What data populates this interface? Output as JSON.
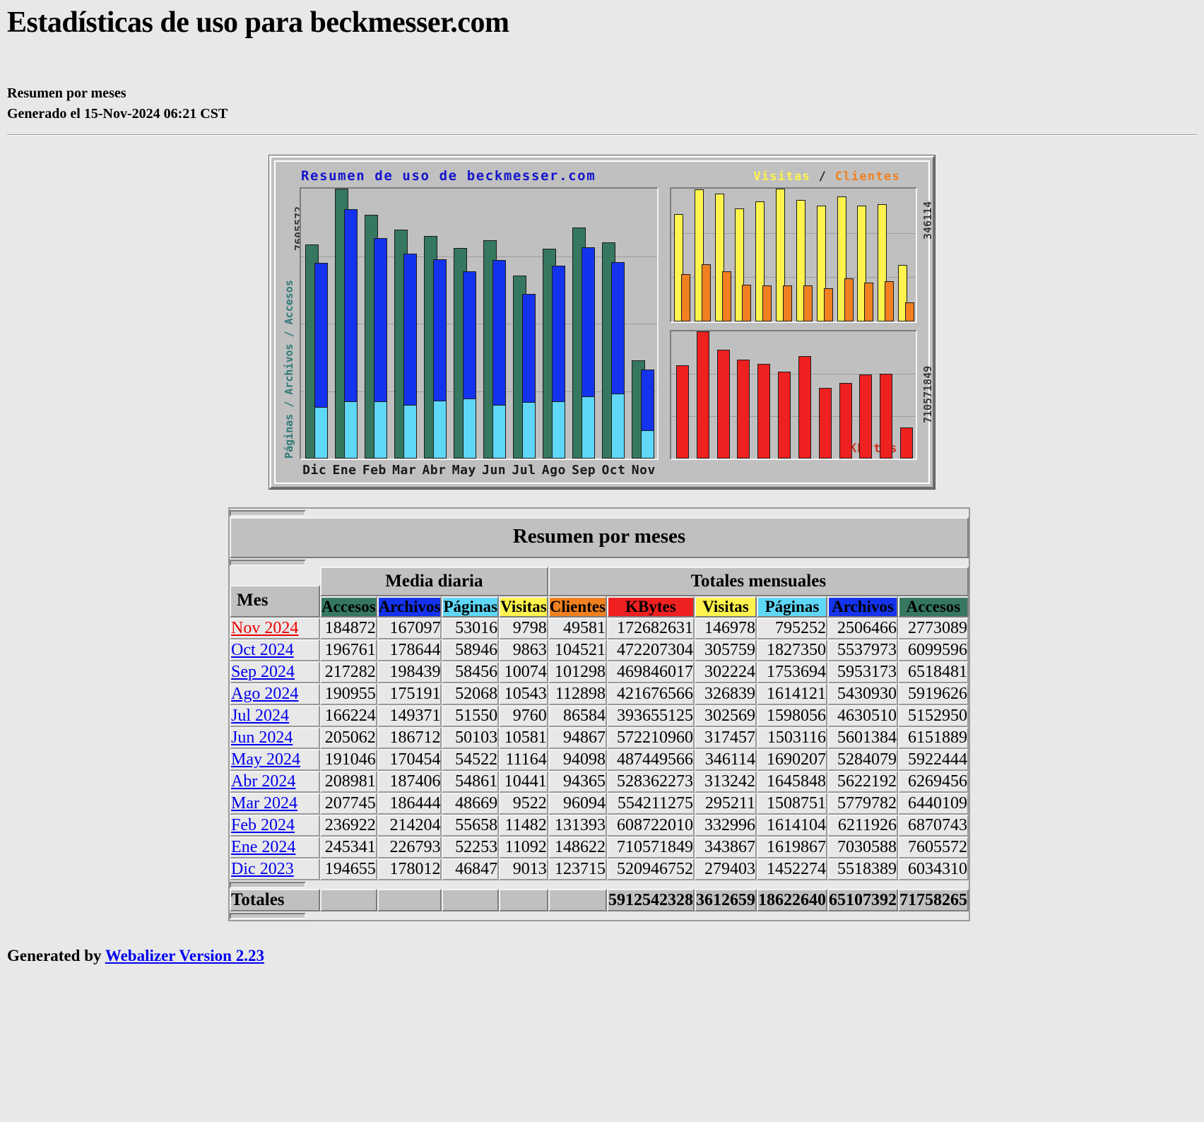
{
  "page": {
    "title": "Estadísticas de uso para beckmesser.com",
    "subtitle": "Resumen por meses",
    "generated": "Generado el 15-Nov-2024 06:21 CST"
  },
  "graph": {
    "title": "Resumen de uso de beckmesser.com",
    "legend_visits": "Visitas",
    "legend_sep": "/",
    "legend_sites": "Clientes",
    "left_axis_max": "7605572",
    "left_axis_label": "Páginas / Archivos / Accesos",
    "right_axis_top_max": "346114",
    "right_axis_bottom_max": "710571849",
    "kbytes_label": "KBytes",
    "x_labels": [
      "Dic",
      "Ene",
      "Feb",
      "Mar",
      "Abr",
      "May",
      "Jun",
      "Jul",
      "Ago",
      "Sep",
      "Oct",
      "Nov"
    ]
  },
  "table": {
    "caption": "Resumen por meses",
    "group_headers": [
      "Media diaria",
      "Totales mensuales"
    ],
    "month_header": "Mes",
    "columns": [
      "Accesos",
      "Archivos",
      "Páginas",
      "Visitas",
      "Clientes",
      "KBytes",
      "Visitas",
      "Páginas",
      "Archivos",
      "Accesos"
    ],
    "totals_label": "Totales",
    "totals": [
      "5912542328",
      "3612659",
      "18622640",
      "65107392",
      "71758265"
    ],
    "rows": [
      {
        "month": "Nov 2024",
        "current": true,
        "values": [
          "184872",
          "167097",
          "53016",
          "9798",
          "49581",
          "172682631",
          "146978",
          "795252",
          "2506466",
          "2773089"
        ]
      },
      {
        "month": "Oct 2024",
        "current": false,
        "values": [
          "196761",
          "178644",
          "58946",
          "9863",
          "104521",
          "472207304",
          "305759",
          "1827350",
          "5537973",
          "6099596"
        ]
      },
      {
        "month": "Sep 2024",
        "current": false,
        "values": [
          "217282",
          "198439",
          "58456",
          "10074",
          "101298",
          "469846017",
          "302224",
          "1753694",
          "5953173",
          "6518481"
        ]
      },
      {
        "month": "Ago 2024",
        "current": false,
        "values": [
          "190955",
          "175191",
          "52068",
          "10543",
          "112898",
          "421676566",
          "326839",
          "1614121",
          "5430930",
          "5919626"
        ]
      },
      {
        "month": "Jul 2024",
        "current": false,
        "values": [
          "166224",
          "149371",
          "51550",
          "9760",
          "86584",
          "393655125",
          "302569",
          "1598056",
          "4630510",
          "5152950"
        ]
      },
      {
        "month": "Jun 2024",
        "current": false,
        "values": [
          "205062",
          "186712",
          "50103",
          "10581",
          "94867",
          "572210960",
          "317457",
          "1503116",
          "5601384",
          "6151889"
        ]
      },
      {
        "month": "May 2024",
        "current": false,
        "values": [
          "191046",
          "170454",
          "54522",
          "11164",
          "94098",
          "487449566",
          "346114",
          "1690207",
          "5284079",
          "5922444"
        ]
      },
      {
        "month": "Abr 2024",
        "current": false,
        "values": [
          "208981",
          "187406",
          "54861",
          "10441",
          "94365",
          "528362273",
          "313242",
          "1645848",
          "5622192",
          "6269456"
        ]
      },
      {
        "month": "Mar 2024",
        "current": false,
        "values": [
          "207745",
          "186444",
          "48669",
          "9522",
          "96094",
          "554211275",
          "295211",
          "1508751",
          "5779782",
          "6440109"
        ]
      },
      {
        "month": "Feb 2024",
        "current": false,
        "values": [
          "236922",
          "214204",
          "55658",
          "11482",
          "131393",
          "608722010",
          "332996",
          "1614104",
          "6211926",
          "6870743"
        ]
      },
      {
        "month": "Ene 2024",
        "current": false,
        "values": [
          "245341",
          "226793",
          "52253",
          "11092",
          "148622",
          "710571849",
          "343867",
          "1619867",
          "7030588",
          "7605572"
        ]
      },
      {
        "month": "Dic 2023",
        "current": false,
        "values": [
          "194655",
          "178012",
          "46847",
          "9013",
          "123715",
          "520946752",
          "279403",
          "1452274",
          "5518389",
          "6034310"
        ]
      }
    ]
  },
  "footer": {
    "prefix": "Generated by ",
    "link": "Webalizer Version 2.23"
  },
  "chart_data": {
    "type": "bar",
    "title": "Resumen de uso de beckmesser.com",
    "categories": [
      "Dic",
      "Ene",
      "Feb",
      "Mar",
      "Abr",
      "May",
      "Jun",
      "Jul",
      "Ago",
      "Sep",
      "Oct",
      "Nov"
    ],
    "panels": [
      {
        "name": "hits-files-pages",
        "ylabel": "Páginas / Archivos / Accesos",
        "ylim": [
          0,
          7605572
        ],
        "series": [
          {
            "name": "Accesos",
            "color": "#35785F",
            "values": [
              6034310,
              7605572,
              6870743,
              6440109,
              6269456,
              5922444,
              6151889,
              5152950,
              5919626,
              6518481,
              6099596,
              2773089
            ]
          },
          {
            "name": "Archivos",
            "color": "#1433EE",
            "values": [
              5518389,
              7030588,
              6211926,
              5779782,
              5622192,
              5284079,
              5601384,
              4630510,
              5430930,
              5953173,
              5537973,
              2506466
            ]
          },
          {
            "name": "Páginas",
            "color": "#5FD7F7",
            "values": [
              1452274,
              1619867,
              1614104,
              1508751,
              1645848,
              1690207,
              1503116,
              1598056,
              1614121,
              1753694,
              1827350,
              795252
            ]
          }
        ]
      },
      {
        "name": "visits-sites",
        "ylabel": "Visitas / Clientes",
        "ylim": [
          0,
          346114
        ],
        "series": [
          {
            "name": "Visitas",
            "color": "#FFF34D",
            "values": [
              279403,
              343867,
              332996,
              295211,
              313242,
              346114,
              317457,
              302569,
              326839,
              302224,
              305759,
              146978
            ]
          },
          {
            "name": "Clientes",
            "color": "#F08020",
            "values": [
              123715,
              148622,
              131393,
              96094,
              94365,
              94098,
              94867,
              86584,
              112898,
              101298,
              104521,
              49581
            ]
          }
        ]
      },
      {
        "name": "kbytes",
        "ylabel": "KBytes",
        "ylim": [
          0,
          710571849
        ],
        "series": [
          {
            "name": "KBytes",
            "color": "#EE2020",
            "values": [
              520946752,
              710571849,
              608722010,
              554211275,
              528362273,
              487449566,
              572210960,
              393655125,
              421676566,
              469846017,
              472207304,
              172682631
            ]
          }
        ]
      }
    ]
  }
}
